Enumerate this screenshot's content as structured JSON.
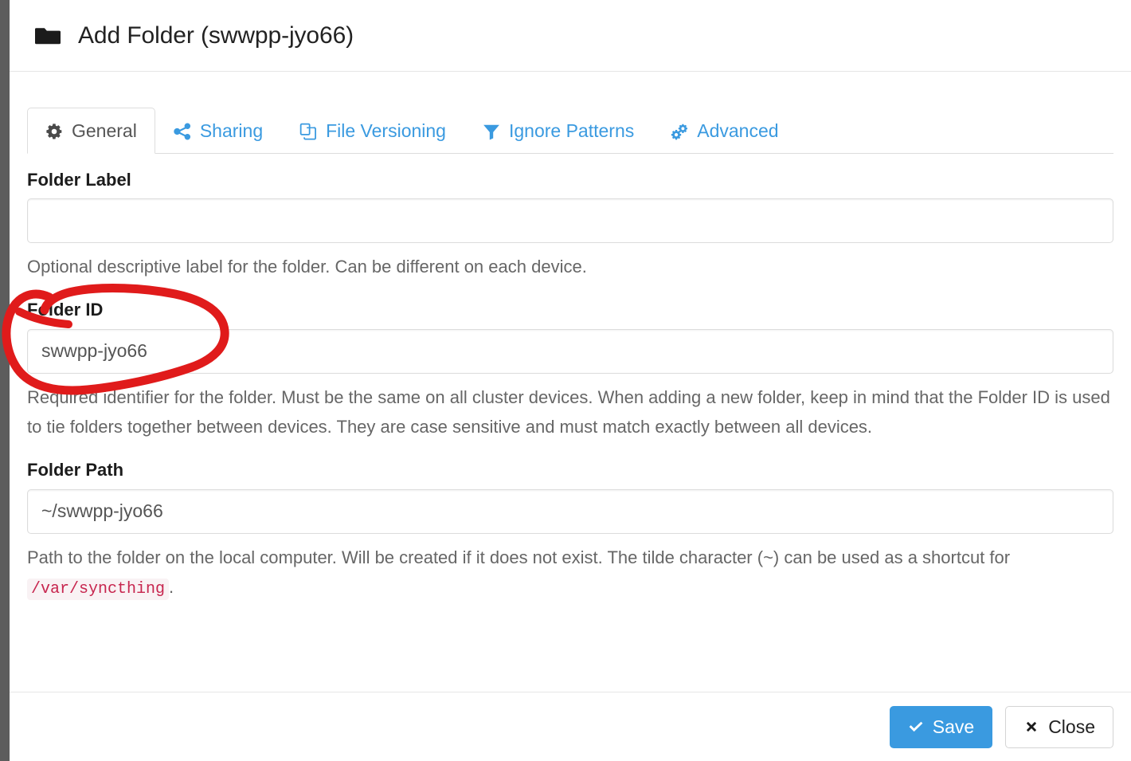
{
  "window": {
    "title": "Add Folder (swwpp-jyo66)",
    "title_icon": "folder-icon"
  },
  "tabs": [
    {
      "id": "general",
      "label": "General",
      "icon": "gear-icon",
      "active": true
    },
    {
      "id": "sharing",
      "label": "Sharing",
      "icon": "share-icon",
      "active": false
    },
    {
      "id": "file-versioning",
      "label": "File Versioning",
      "icon": "copy-files-icon",
      "active": false
    },
    {
      "id": "ignore-patterns",
      "label": "Ignore Patterns",
      "icon": "filter-icon",
      "active": false
    },
    {
      "id": "advanced",
      "label": "Advanced",
      "icon": "gears-icon",
      "active": false
    }
  ],
  "form": {
    "folder_label": {
      "label": "Folder Label",
      "value": "",
      "placeholder": "",
      "help": "Optional descriptive label for the folder. Can be different on each device."
    },
    "folder_id": {
      "label": "Folder ID",
      "value": "swwpp-jyo66",
      "placeholder": "",
      "help": "Required identifier for the folder. Must be the same on all cluster devices. When adding a new folder, keep in mind that the Folder ID is used to tie folders together between devices. They are case sensitive and must match exactly between all devices."
    },
    "folder_path": {
      "label": "Folder Path",
      "value": "~/swwpp-jyo66",
      "placeholder": "",
      "help_before": "Path to the folder on the local computer. Will be created if it does not exist. The tilde character (~) can be used as a shortcut for ",
      "help_code": "/var/syncthing",
      "help_after": "."
    }
  },
  "footer": {
    "save_label": "Save",
    "save_icon": "check-icon",
    "close_label": "Close",
    "close_icon": "times-icon"
  },
  "annotation": {
    "type": "hand-drawn-circle",
    "color": "#e01b1b",
    "targets": "Folder ID label and Folder ID input"
  },
  "colors": {
    "accent": "#3a9ae0",
    "annotation_red": "#e01b1b",
    "code_text": "#c7254e",
    "code_bg": "#f9f2f4",
    "backdrop": "#5d5d5d"
  }
}
